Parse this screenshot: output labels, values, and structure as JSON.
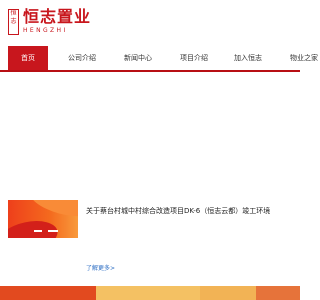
{
  "logo": {
    "seal_text": "恒志",
    "name_cn": "恒志置业",
    "name_en": "HENGZHI"
  },
  "nav": {
    "items": [
      {
        "label": "首页",
        "active": true
      },
      {
        "label": "公司介绍",
        "active": false
      },
      {
        "label": "新闻中心",
        "active": false
      },
      {
        "label": "项目介绍",
        "active": false
      },
      {
        "label": "加入恒志",
        "active": false
      },
      {
        "label": "物业之家",
        "active": false
      }
    ]
  },
  "news": {
    "title": "关于蔡台村城中村综合改造项目DK-6（恒志云都）竣工环境",
    "more_label": "了解更多>"
  },
  "colors": {
    "brand_red": "#c8161d",
    "bottom_segments": [
      "#e24a1f",
      "#f4c163",
      "#f2b355",
      "#e6733a"
    ]
  }
}
